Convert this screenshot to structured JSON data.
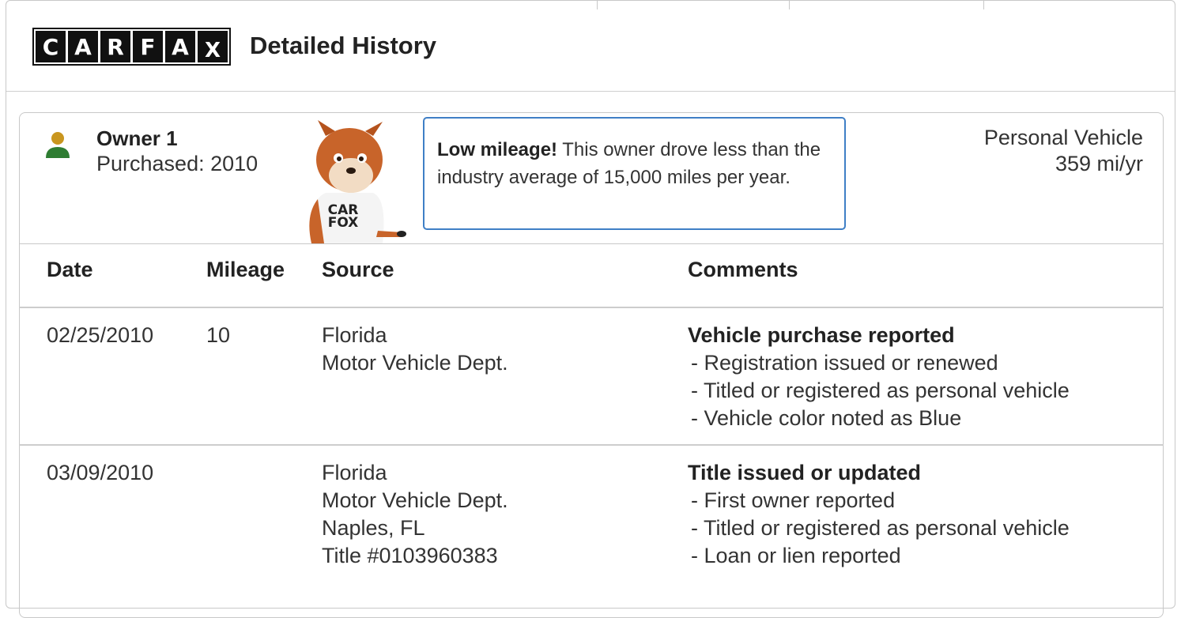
{
  "header": {
    "logo_letters": [
      "C",
      "A",
      "R",
      "F",
      "A",
      "X"
    ],
    "title": "Detailed History"
  },
  "owner": {
    "title": "Owner 1",
    "purchased": "Purchased: 2010",
    "vehicle_type": "Personal Vehicle",
    "mileage_rate": "359 mi/yr",
    "icon": "person-icon",
    "icon_colors": {
      "head": "#c9961f",
      "body": "#2e7d32"
    }
  },
  "callout": {
    "bold": "Low mileage!",
    "text": " This owner drove less than the industry average of 15,000 miles per year."
  },
  "mascot": {
    "shirt_text_1": "CAR",
    "shirt_text_2": "FOX"
  },
  "table": {
    "columns": [
      "Date",
      "Mileage",
      "Source",
      "Comments"
    ],
    "rows": [
      {
        "date": "02/25/2010",
        "mileage": "10",
        "source": [
          "Florida",
          "Motor Vehicle Dept."
        ],
        "comment_head": "Vehicle purchase reported",
        "comment_items": [
          "- Registration issued or renewed",
          "- Titled or registered as personal vehicle",
          "- Vehicle color noted as Blue"
        ]
      },
      {
        "date": "03/09/2010",
        "mileage": "",
        "source": [
          "Florida",
          "Motor Vehicle Dept.",
          "Naples, FL",
          "Title #0103960383"
        ],
        "comment_head": "Title issued or updated",
        "comment_items": [
          "- First owner reported",
          "- Titled or registered as personal vehicle",
          "- Loan or lien reported"
        ]
      }
    ]
  },
  "colors": {
    "callout_border": "#3f7fc6",
    "border": "#c8c8c8"
  }
}
